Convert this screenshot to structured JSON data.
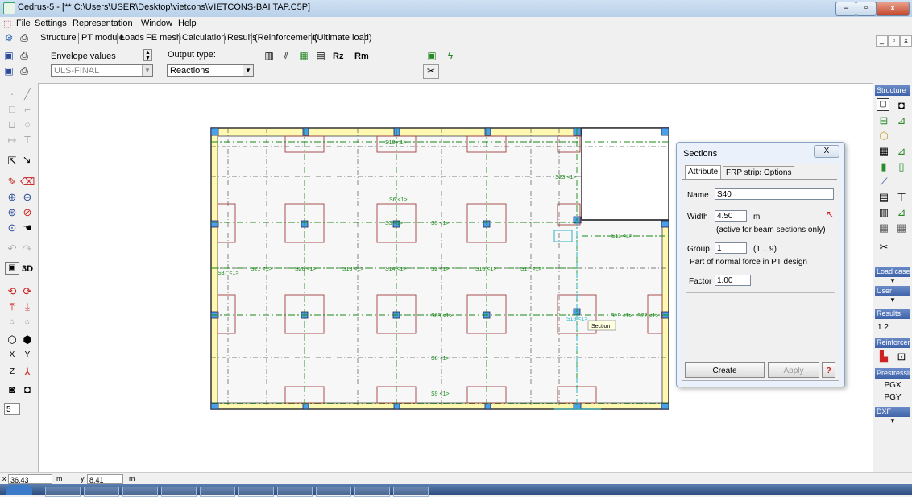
{
  "window": {
    "title": "Cedrus-5 - [** C:\\Users\\USER\\Desktop\\vietcons\\VIETCONS-BAI TAP.C5P]"
  },
  "menu": [
    "File",
    "Settings",
    "Representation",
    "Window",
    "Help"
  ],
  "tabs": [
    "Structure",
    "PT module",
    "Loads",
    "FE mesh",
    "Calculation",
    "Results",
    "(Reinforcement)",
    "(Ultimate load)"
  ],
  "toolbar": {
    "envelope_label": "Envelope values",
    "envelope_value": "ULS-FINAL",
    "output_type_label": "Output type:",
    "output_type_value": "Reactions",
    "rz_label": "Rz",
    "rm_label": "Rm"
  },
  "left_palette": {
    "btn_3d": "3D",
    "x_label": "X",
    "y_label": "Y",
    "z_label": "Z",
    "spin_value": "5"
  },
  "right_palette": {
    "structure": "Structure",
    "load_cases": "Load cases",
    "user": "User",
    "results": "Results",
    "results_nums": "1  2",
    "reinforcement": "Reinforcem",
    "prestressing": "Prestressin",
    "pgx": "PGX",
    "pgy": "PGY",
    "dxf": "DXF"
  },
  "drawing": {
    "labels": [
      "S10 <1>",
      "S6 <1>",
      "S23 <1>",
      "S3 <1>",
      "S5 <1>",
      "S11 <1>",
      "S37 <1>",
      "S21 <1>",
      "S26 <1>",
      "S13 <1>",
      "S14 <1>",
      "S2 <1>",
      "S16 <1>",
      "S17 <1>",
      "S69 <1>",
      "S18 <1>",
      "S19 <1>",
      "S22 <1>",
      "S8 <1>",
      "S9 <1>"
    ],
    "tooltip": "Section"
  },
  "dialog": {
    "title": "Sections",
    "close": "X",
    "tabs": [
      "Attribute",
      "FRP strips",
      "Options"
    ],
    "name_label": "Name",
    "name_value": "S40",
    "width_label": "Width",
    "width_value": "4.50",
    "width_unit": "m",
    "width_note": "(active for beam sections only)",
    "group_label": "Group",
    "group_value": "1",
    "group_range": "(1 .. 9)",
    "normal_force_title": "Part of normal force in PT design",
    "factor_label": "Factor",
    "factor_value": "1.00",
    "create": "Create",
    "apply": "Apply",
    "help": "?"
  },
  "status": {
    "x_label": "x",
    "x_value": "36.43",
    "x_unit": "m",
    "y_label": "y",
    "y_value": "8.41",
    "y_unit": "m"
  },
  "colors": {
    "slab": "#fff8b0",
    "column": "#4aa0e8",
    "section": "#1a8a1a",
    "dropdrop": "#a04040"
  }
}
